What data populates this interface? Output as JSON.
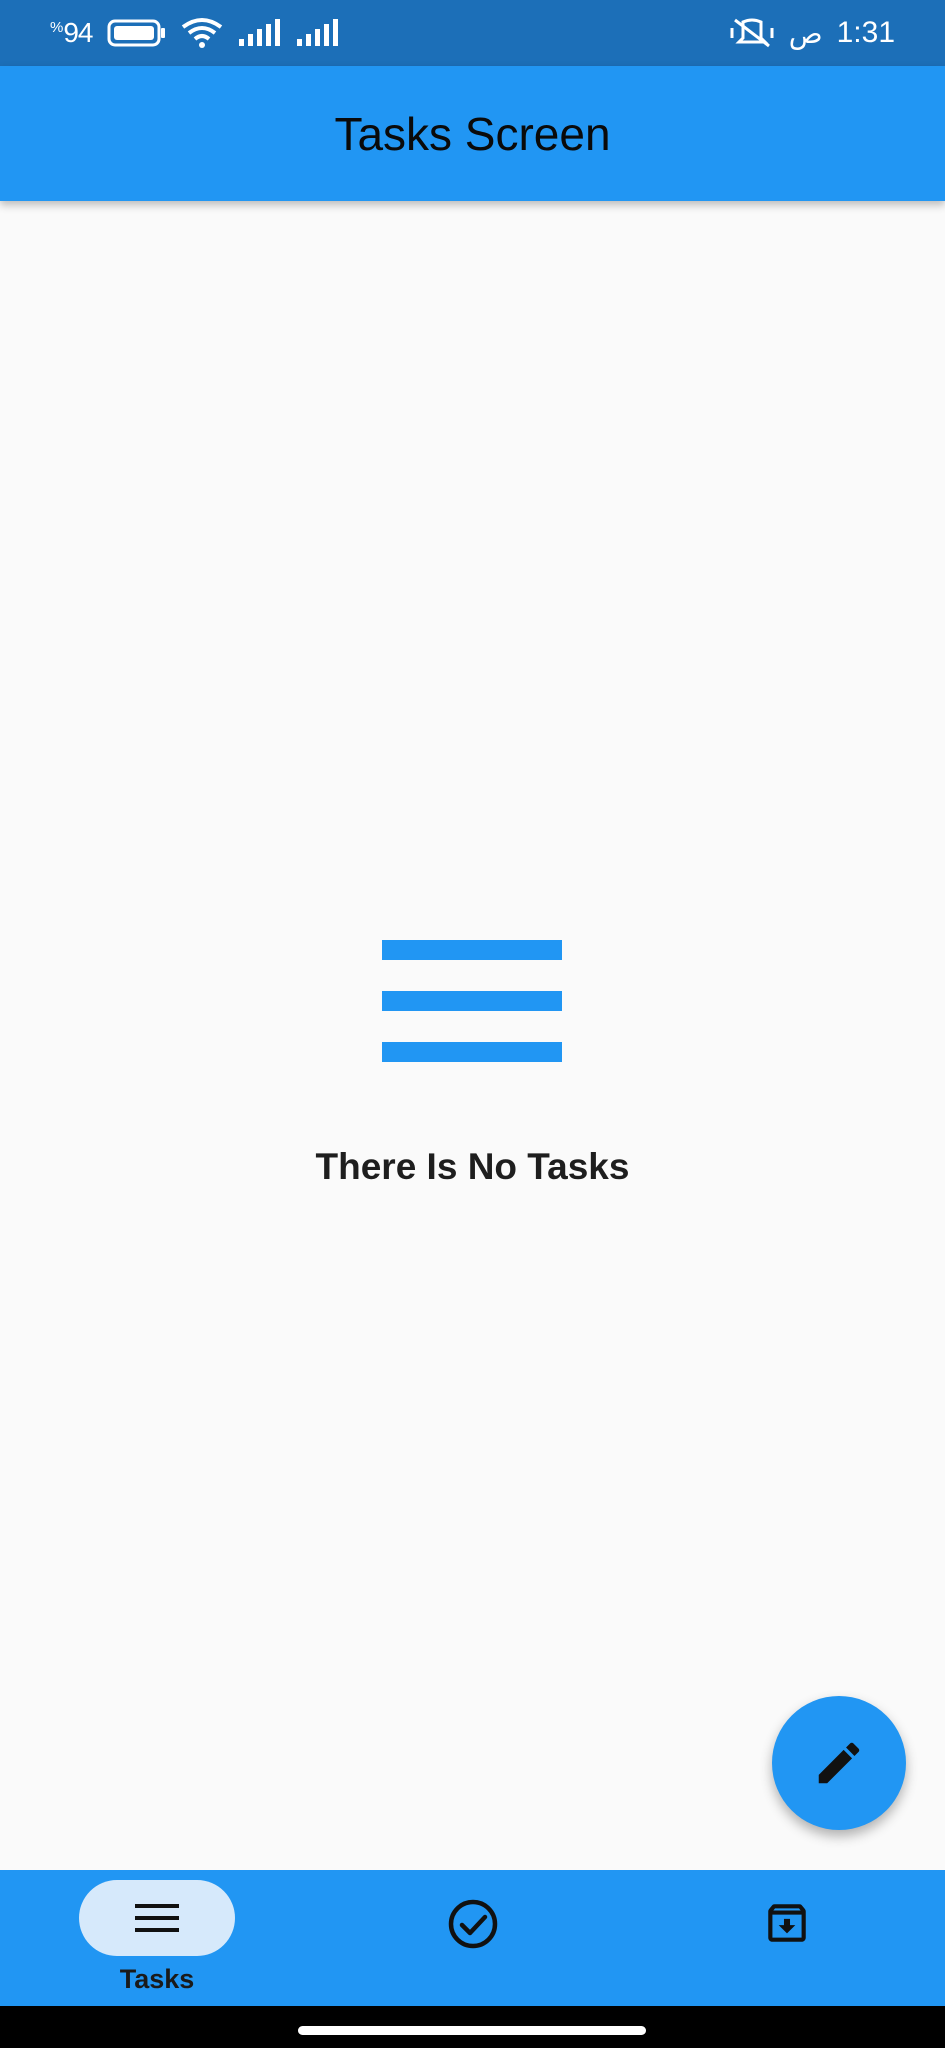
{
  "status_bar": {
    "battery": "94",
    "battery_unit": "%",
    "time": "1:31",
    "ampm": "ص",
    "icons": [
      "battery-icon",
      "wifi-icon",
      "signal-icon",
      "signal-icon",
      "vibrate-icon",
      "alarm-off-icon"
    ]
  },
  "app_bar": {
    "title": "Tasks Screen"
  },
  "empty_state": {
    "icon": "menu-lines-icon",
    "message": "There Is No Tasks"
  },
  "fab": {
    "icon": "edit-icon"
  },
  "bottom_nav": {
    "items": [
      {
        "label": "Tasks",
        "icon": "menu-icon",
        "selected": true
      },
      {
        "label": "",
        "icon": "check-circle-icon",
        "selected": false
      },
      {
        "label": "",
        "icon": "archive-icon",
        "selected": false
      }
    ]
  },
  "colors": {
    "primary": "#2196f3",
    "status_bar": "#1c6fb8",
    "selected_pill": "#d6e9fb",
    "background": "#fafafa"
  }
}
